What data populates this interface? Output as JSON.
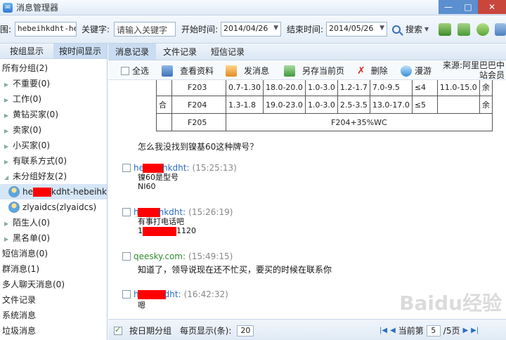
{
  "window": {
    "title": "消息管理器",
    "min": "—",
    "max": "□",
    "close": "✕"
  },
  "toolbar": {
    "range_label": "围:",
    "range_value": "hebeihkdht-hel",
    "keyword_label": "关键字:",
    "keyword_placeholder": "请输入关键字",
    "start_label": "开始时间:",
    "start_date": "2014/04/26",
    "end_label": "结束时间:",
    "end_date": "2014/05/26",
    "search_label": "搜索"
  },
  "left": {
    "tabs": [
      {
        "label": "按组显示"
      },
      {
        "label": "按时间显示"
      }
    ],
    "tree": {
      "all_groups": "所有分组(2)",
      "groups": [
        {
          "label": "不重要(0)"
        },
        {
          "label": "工作(0)"
        },
        {
          "label": "黄钻买家(0)"
        },
        {
          "label": "卖家(0)"
        },
        {
          "label": "小买家(0)"
        },
        {
          "label": "有联系方式(0)"
        },
        {
          "label": "未分组好友(2)"
        }
      ],
      "contacts": [
        {
          "prefix": "he",
          "suffix": "kdht-hebeihk"
        },
        {
          "prefix": "zlyaidcs(zlyaidcs)",
          "suffix": ""
        }
      ],
      "groups2": [
        {
          "label": "陌生人(0)"
        },
        {
          "label": "黑名单(0)"
        }
      ],
      "others": [
        {
          "label": "短信消息(0)"
        },
        {
          "label": "群消息(1)"
        },
        {
          "label": "多人聊天消息(0)"
        },
        {
          "label": "文件记录"
        },
        {
          "label": "系统消息"
        },
        {
          "label": "垃圾消息"
        }
      ]
    }
  },
  "right": {
    "tabs": [
      {
        "label": "消息记录"
      },
      {
        "label": "文件记录"
      },
      {
        "label": "短信记录"
      }
    ],
    "actions": {
      "select_all": "全选",
      "view_profile": "查看资料",
      "send_message": "发消息",
      "save_page": "另存当前页",
      "delete": "删除",
      "roam": "漫游"
    },
    "source_line1": "来源:阿里巴巴中",
    "source_line2": "站会员"
  },
  "spec_table": {
    "rows": [
      {
        "label": "",
        "grade": "F203",
        "c1": "0.7-1.30",
        "c2": "18.0-20.0",
        "c3": "1.0-3.0",
        "c4": "1.2-1.7",
        "c5": "7.0-9.5",
        "c6": "≤4",
        "c7": "11.0-15.0",
        "c8": "余"
      },
      {
        "label": "合",
        "grade": "F204",
        "c1": "1.3-1.8",
        "c2": "19.0-23.0",
        "c3": "1.0-3.0",
        "c4": "2.5-3.5",
        "c5": "13.0-17.0",
        "c6": "≤5",
        "c7": "",
        "c8": "余"
      },
      {
        "label": "",
        "grade": "F205",
        "merged": "F204+35%WC"
      }
    ]
  },
  "messages": {
    "question": "怎么我没找到镍基60这种牌号？",
    "items": [
      {
        "name_pre": "he",
        "name_post": "hkdht:",
        "time": "(15:25:13)",
        "lines": [
          "镍60是型号",
          "NI60"
        ]
      },
      {
        "name_pre": "h",
        "name_post": "hkdht:",
        "time": "(15:26:19)",
        "lines": [
          "有事打电话吧"
        ],
        "phone_pre": "1",
        "phone_post": "1120"
      },
      {
        "name_pre": "qeesky.com:",
        "name_post": "",
        "time": "(15:49:15)",
        "lines": [
          "知道了，领导说现在还不忙买，要买的时候在联系你"
        ]
      },
      {
        "name_pre": "h",
        "name_post": "dht:",
        "time": "(16:42:32)",
        "lines": [
          "嗯"
        ]
      }
    ]
  },
  "bottom": {
    "group_by_date": "按日期分组",
    "per_page_label": "每页显示(条):",
    "per_page_value": "20",
    "current_label": "当前第",
    "current_page": "5",
    "total": "/5页"
  },
  "watermark": "Baidu经验",
  "colors": {
    "accent": "#2a6bc1",
    "redaction": "#ff0000",
    "close_button": "#c9463d"
  }
}
